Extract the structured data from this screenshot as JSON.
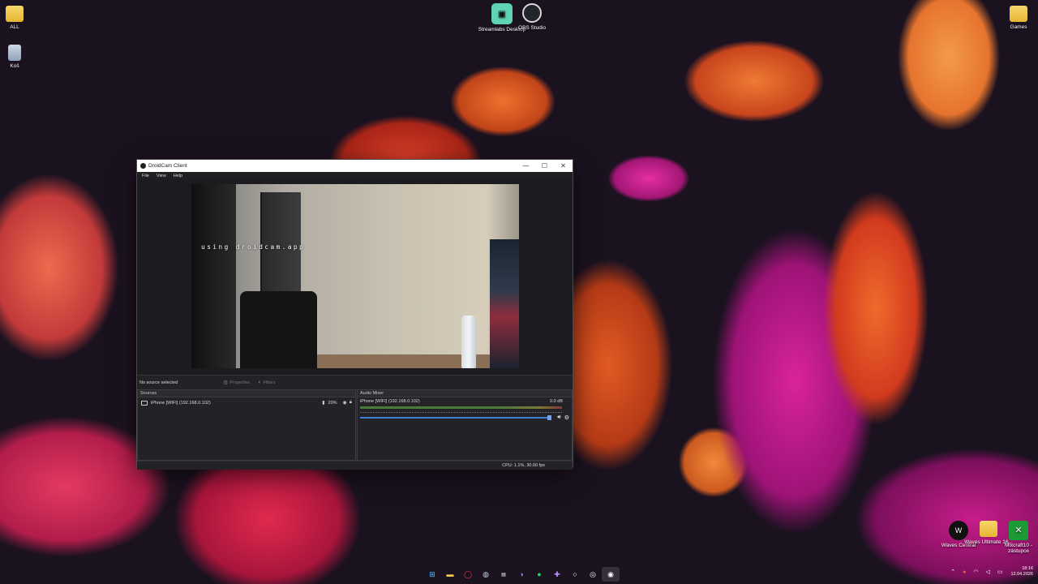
{
  "desktop": {
    "icons_left": [
      {
        "label": "ALL",
        "icon": "folder-icon"
      },
      {
        "label": "Koš",
        "icon": "recycle-bin-icon"
      }
    ],
    "icons_top": [
      {
        "label": "Streamlabs Desktop",
        "icon": "streamlabs-icon"
      },
      {
        "label": "OBS Studio",
        "icon": "obs-icon"
      }
    ],
    "icon_right_top": {
      "label": "Games",
      "icon": "folder-icon"
    },
    "icons_bottom_right": [
      {
        "label": "Waves Central",
        "icon": "waves-icon"
      },
      {
        "label": "Waves Ultimate 16...",
        "icon": "folder-icon"
      },
      {
        "label": "Mixcraft10 - zástupce",
        "icon": "mixcraft-icon"
      }
    ]
  },
  "window": {
    "title": "DroidCam Client",
    "menu": [
      "File",
      "View",
      "Help"
    ],
    "watermark": "using droidcam.app",
    "source_bar": {
      "no_source": "No source selected",
      "properties": "Properties",
      "filters": "Filters"
    },
    "sources": {
      "heading": "Sources",
      "items": [
        {
          "name": "iPhone [WIFI] (192.168.0.102)",
          "percent": "20%"
        }
      ]
    },
    "mixer": {
      "heading": "Audio Mixer",
      "channel": "iPhone [WIFI] (192.168.0.102)",
      "db": "0.0 dB",
      "volume": 1.0
    },
    "status": "CPU: 1.1%, 30.00 fps"
  },
  "taskbar": {
    "apps": [
      "windows-start-icon",
      "file-explorer-icon",
      "opera-icon",
      "steam-icon",
      "epic-games-icon",
      "discord-icon",
      "spotify-icon",
      "game-controller-icon",
      "github-icon",
      "obs-icon",
      "droidcam-icon"
    ],
    "clock_time": "18:16",
    "clock_date": "12.04.2026"
  },
  "colors": {
    "accent": "#3f7fd8",
    "panel": "#232327",
    "titlebar": "#ffffff"
  }
}
